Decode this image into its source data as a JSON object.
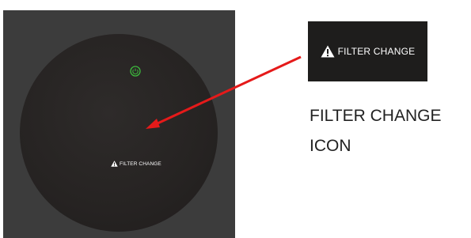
{
  "device": {
    "filter_label": "FILTER CHANGE",
    "indicator_icon": "power-icon",
    "indicator_color": "#3dbb3d"
  },
  "callout": {
    "badge_label": "FILTER CHANGE",
    "badge_icon": "warning-triangle-icon",
    "caption_line1": "FILTER CHANGE",
    "caption_line2": "ICON"
  },
  "arrow_color": "#e51a1a"
}
